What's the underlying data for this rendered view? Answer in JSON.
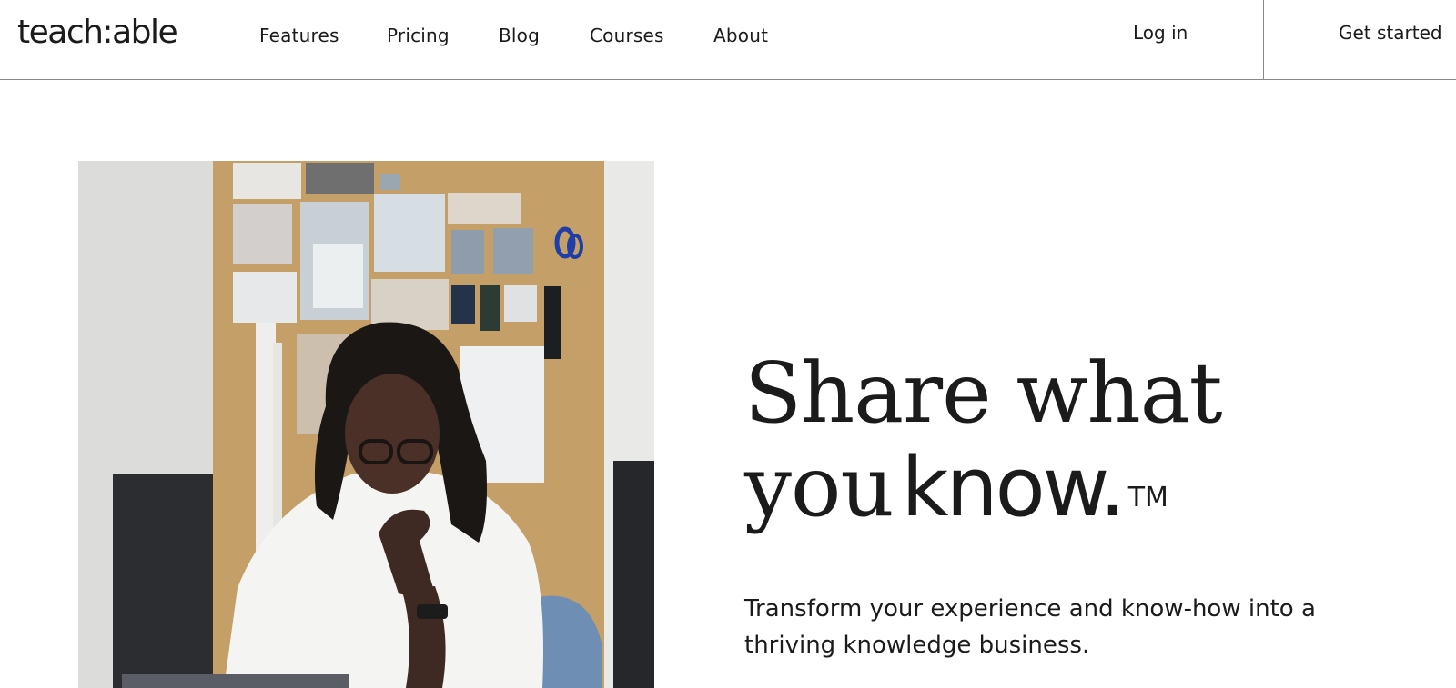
{
  "brand": {
    "logo_text": "teach:able"
  },
  "nav": {
    "items": [
      {
        "label": "Features"
      },
      {
        "label": "Pricing"
      },
      {
        "label": "Blog"
      },
      {
        "label": "Courses"
      },
      {
        "label": "About"
      }
    ],
    "login_label": "Log in",
    "cta_label": "Get started"
  },
  "hero": {
    "title_line1": "Share what",
    "title_line2_serif": "you",
    "title_line2_sans": "know.",
    "trademark": "TM",
    "subtitle": "Transform your experience and know-how into a thriving knowledge business."
  },
  "colors": {
    "text": "#1b1b1b",
    "divider": "#8a8a8a",
    "cork": "#c9a46d",
    "shirt": "#f3f3f1"
  }
}
